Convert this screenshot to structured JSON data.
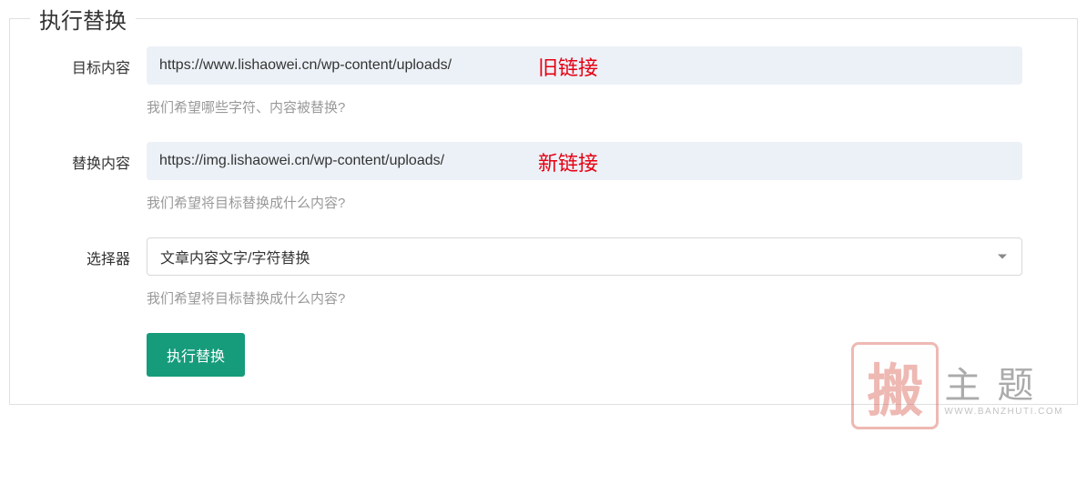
{
  "panel": {
    "title": "执行替换"
  },
  "form": {
    "target": {
      "label": "目标内容",
      "value": "https://www.lishaowei.cn/wp-content/uploads/",
      "help": "我们希望哪些字符、内容被替换?",
      "annotation": "旧链接"
    },
    "replace": {
      "label": "替换内容",
      "value": "https://img.lishaowei.cn/wp-content/uploads/",
      "help": "我们希望将目标替换成什么内容?",
      "annotation": "新链接"
    },
    "selector": {
      "label": "选择器",
      "value": "文章内容文字/字符替换",
      "help": "我们希望将目标替换成什么内容?"
    },
    "submit": {
      "label": "执行替换"
    }
  },
  "watermark": {
    "seal": "搬",
    "main": "主题",
    "sub": "WWW.BANZHUTI.COM"
  }
}
